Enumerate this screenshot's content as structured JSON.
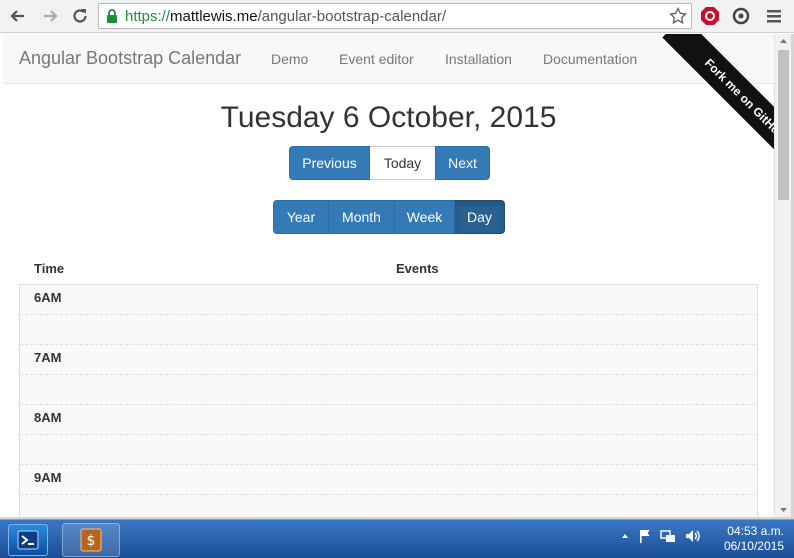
{
  "browser": {
    "url_scheme": "https://",
    "url_host": "mattlewis.me",
    "url_path": "/angular-bootstrap-calendar/"
  },
  "navbar": {
    "brand": "Angular Bootstrap Calendar",
    "links": [
      "Demo",
      "Event editor",
      "Installation",
      "Documentation"
    ],
    "ribbon": "Fork me on GitHub"
  },
  "calendar": {
    "title": "Tuesday 6 October, 2015",
    "nav": {
      "previous": "Previous",
      "today": "Today",
      "next": "Next"
    },
    "views": {
      "year": "Year",
      "month": "Month",
      "week": "Week",
      "day": "Day"
    },
    "active_view": "Day",
    "columns": {
      "time": "Time",
      "events": "Events"
    },
    "hours": [
      "6AM",
      "7AM",
      "8AM",
      "9AM"
    ]
  },
  "taskbar": {
    "time": "04:53 a.m.",
    "date": "06/10/2015"
  },
  "colors": {
    "primary": "#337ab7",
    "primary_active": "#286090",
    "taskbar": "#1b4f96"
  }
}
